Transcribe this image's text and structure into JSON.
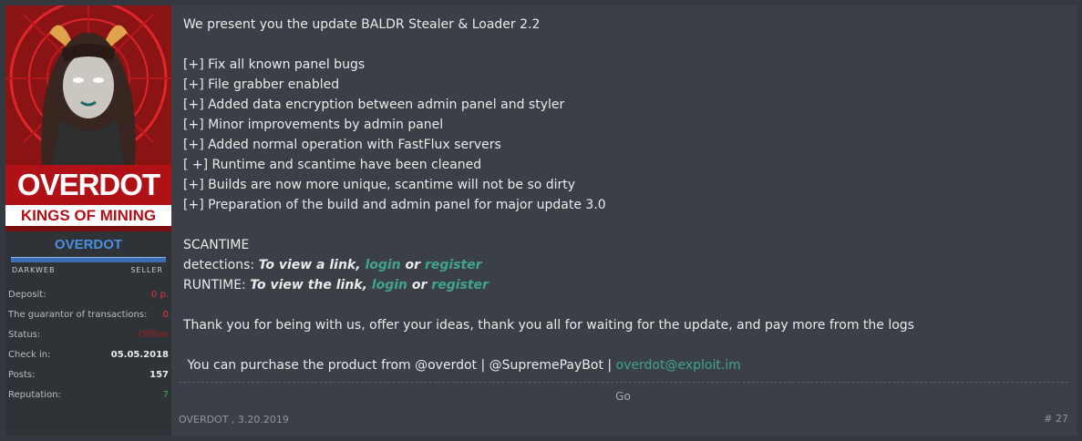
{
  "sidebar": {
    "avatar_title": "OVERDOT",
    "avatar_subtitle": "KINGS OF MINING",
    "username": "OVERDOT",
    "rank_left": "DARKWEB",
    "rank_right": "SELLER",
    "stats": [
      {
        "label": "Deposit:",
        "value": "0 р."
      },
      {
        "label": "The guarantor of transactions:",
        "value": "0"
      },
      {
        "label": "Status:",
        "value": "Offline"
      },
      {
        "label": "Check in:",
        "value": "05.05.2018"
      },
      {
        "label": "Posts:",
        "value": "157"
      },
      {
        "label": "Reputation:",
        "value": "7"
      }
    ]
  },
  "post": {
    "intro": "We present you the update BALDR Stealer & Loader 2.2",
    "changes": [
      "[+] Fix all known panel bugs",
      "[+] File grabber enabled",
      "[+] Added data encryption between admin panel and styler",
      "[+] Minor improvements by admin panel",
      "[+] Added normal operation with FastFlux servers",
      "[ +] Runtime and scantime have been cleaned",
      "[+] Builds are now more unique, scantime will not be so dirty",
      "[+] Preparation of the build and admin panel for major update 3.0"
    ],
    "scantime_heading": "SCANTIME",
    "detections_label": "detections: ",
    "detections_notice": "To view a link, ",
    "runtime_label": "RUNTIME: ",
    "runtime_notice": "To view the link, ",
    "login": "login",
    "or": " or ",
    "register": "register",
    "thanks": "Thank you for being with us, offer your ideas, thank you all for waiting for the update, and pay more from the logs",
    "purchase_prefix": " You can purchase the product from @overdot | @SupremePayBot | ",
    "purchase_email": "overdot@exploit.im"
  },
  "go_label": "Go",
  "footer": {
    "author_date": "OVERDOT , 3.20.2019",
    "post_number": "# 27"
  },
  "colors": {
    "link": "#3fa58b",
    "username": "#4a90e2",
    "offline": "#a51e1e",
    "reputation": "#3fae3f"
  }
}
